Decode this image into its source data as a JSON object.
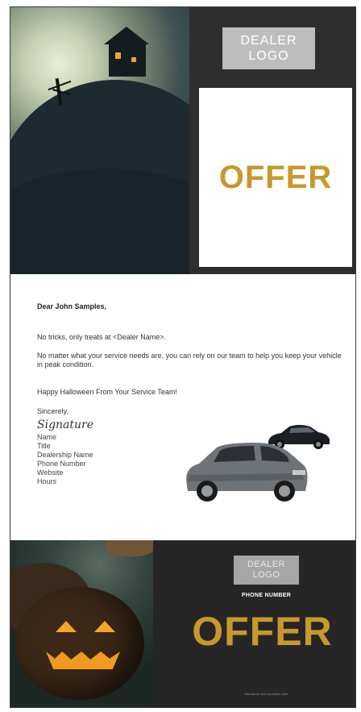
{
  "top_panel": {
    "dealer_logo": "DEALER\nLOGO",
    "offer": "OFFER"
  },
  "letter": {
    "greeting": "Dear John Samples,",
    "line1": "No tricks, only treats at <Dealer Name>.",
    "line2": "No matter what your service needs are, you can rely on our team to help you keep your vehicle in peak condition.",
    "line3": "Happy Halloween From Your Service Team!",
    "closing": "Sincerely,",
    "signature": "Signature",
    "details": [
      "Name",
      "Title",
      "Dealership Name",
      "Phone Number",
      "Website",
      "Hours"
    ]
  },
  "bottom_panel": {
    "dealer_logo": "DEALER\nLOGO",
    "phone": "PHONE NUMBER",
    "offer": "OFFER",
    "disclaimer": "Disclaimer and expiration date"
  },
  "colors": {
    "offer_gold": "#c8982c",
    "dark_panel": "#2e2e2e"
  }
}
